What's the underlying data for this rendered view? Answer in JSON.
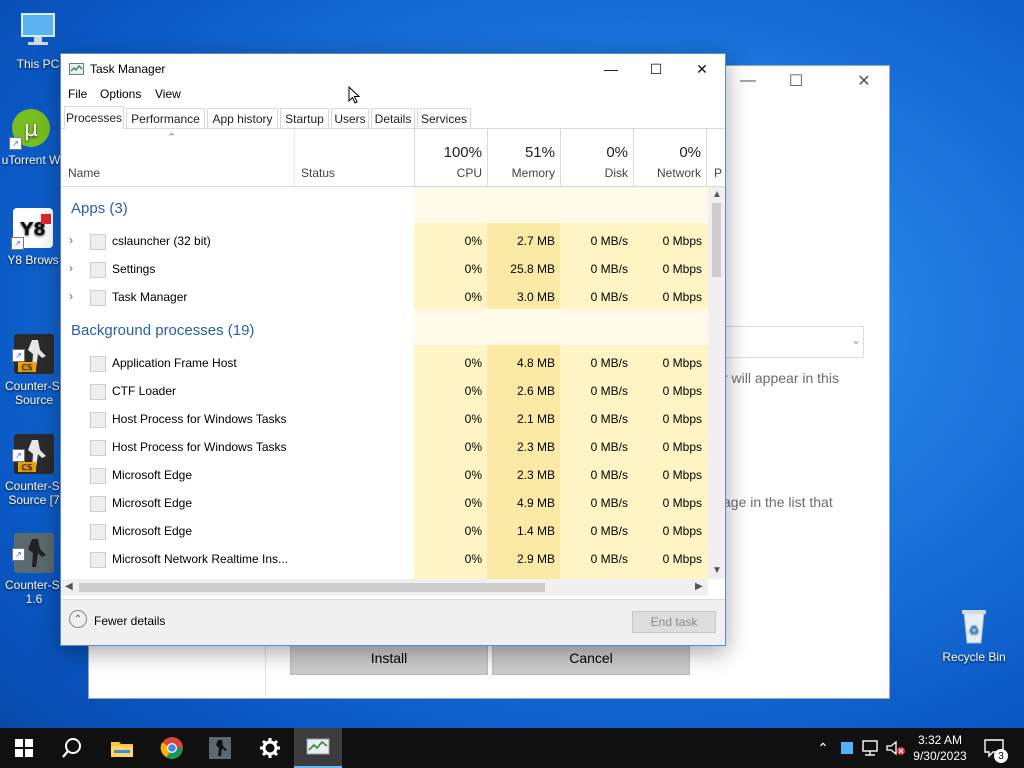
{
  "desktop": {
    "icons": [
      {
        "label": "This PC",
        "icon": "monitor-icon"
      },
      {
        "label": "uTorrent W",
        "icon": "utorrent-icon"
      },
      {
        "label": "Y8 Brows",
        "icon": "y8-icon"
      },
      {
        "label": "Counter-St\nSource",
        "icon": "counter-strike-icon"
      },
      {
        "label": "Counter-St\nSource [7",
        "icon": "counter-strike-icon"
      },
      {
        "label": "Counter-St\n1.6",
        "icon": "counter-strike-icon"
      },
      {
        "label": "Recycle Bin",
        "icon": "recycle-bin-icon"
      }
    ]
  },
  "installer": {
    "text1": "r will appear in this",
    "text2": "age in the list that",
    "install_label": "Install",
    "cancel_label": "Cancel"
  },
  "taskmanager": {
    "title": "Task Manager",
    "menu": [
      "File",
      "Options",
      "View"
    ],
    "tabs": [
      "Processes",
      "Performance",
      "App history",
      "Startup",
      "Users",
      "Details",
      "Services"
    ],
    "columns": {
      "name": "Name",
      "status": "Status",
      "cpu": {
        "pct": "100%",
        "label": "CPU"
      },
      "memory": {
        "pct": "51%",
        "label": "Memory"
      },
      "disk": {
        "pct": "0%",
        "label": "Disk"
      },
      "network": {
        "pct": "0%",
        "label": "Network"
      },
      "partial": "P"
    },
    "groups": {
      "apps": "Apps (3)",
      "background": "Background processes (19)"
    },
    "apps": [
      {
        "name": "cslauncher (32 bit)",
        "cpu": "0%",
        "mem": "2.7 MB",
        "disk": "0 MB/s",
        "net": "0 Mbps"
      },
      {
        "name": "Settings",
        "cpu": "0%",
        "mem": "25.8 MB",
        "disk": "0 MB/s",
        "net": "0 Mbps"
      },
      {
        "name": "Task Manager",
        "cpu": "0%",
        "mem": "3.0 MB",
        "disk": "0 MB/s",
        "net": "0 Mbps"
      }
    ],
    "background": [
      {
        "name": "Application Frame Host",
        "cpu": "0%",
        "mem": "4.8 MB",
        "disk": "0 MB/s",
        "net": "0 Mbps"
      },
      {
        "name": "CTF Loader",
        "cpu": "0%",
        "mem": "2.6 MB",
        "disk": "0 MB/s",
        "net": "0 Mbps"
      },
      {
        "name": "Host Process for Windows Tasks",
        "cpu": "0%",
        "mem": "2.1 MB",
        "disk": "0 MB/s",
        "net": "0 Mbps"
      },
      {
        "name": "Host Process for Windows Tasks",
        "cpu": "0%",
        "mem": "2.3 MB",
        "disk": "0 MB/s",
        "net": "0 Mbps"
      },
      {
        "name": "Microsoft Edge",
        "cpu": "0%",
        "mem": "2.3 MB",
        "disk": "0 MB/s",
        "net": "0 Mbps"
      },
      {
        "name": "Microsoft Edge",
        "cpu": "0%",
        "mem": "4.9 MB",
        "disk": "0 MB/s",
        "net": "0 Mbps"
      },
      {
        "name": "Microsoft Edge",
        "cpu": "0%",
        "mem": "1.4 MB",
        "disk": "0 MB/s",
        "net": "0 Mbps"
      },
      {
        "name": "Microsoft Network Realtime Ins...",
        "cpu": "0%",
        "mem": "2.9 MB",
        "disk": "0 MB/s",
        "net": "0 Mbps"
      }
    ],
    "fewer_details": "Fewer details",
    "end_task": "End task"
  },
  "taskbar": {
    "time": "3:32 AM",
    "date": "9/30/2023",
    "notification_count": "3"
  },
  "colors": {
    "cpu_col": "#fff4c4",
    "mem_col": "#fbeaa6",
    "group_blue": "#2a5ea8"
  }
}
